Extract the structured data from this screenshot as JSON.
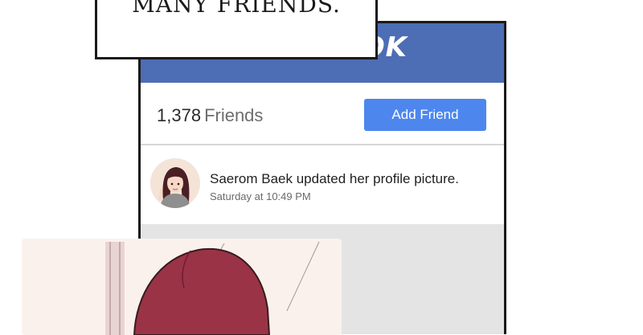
{
  "caption": {
    "text": "MANY FRIENDS."
  },
  "header": {
    "logo_fragment": "OK",
    "color": "#4d6db5"
  },
  "friends": {
    "count": "1,378",
    "label": "Friends",
    "add_button": "Add Friend",
    "button_color": "#4d87ee"
  },
  "post": {
    "title": "Saerom Baek updated her profile picture.",
    "time": "Saturday at 10:49 PM"
  },
  "icons": {
    "avatar": "profile-avatar-image",
    "photo": "profile-picture-image"
  }
}
